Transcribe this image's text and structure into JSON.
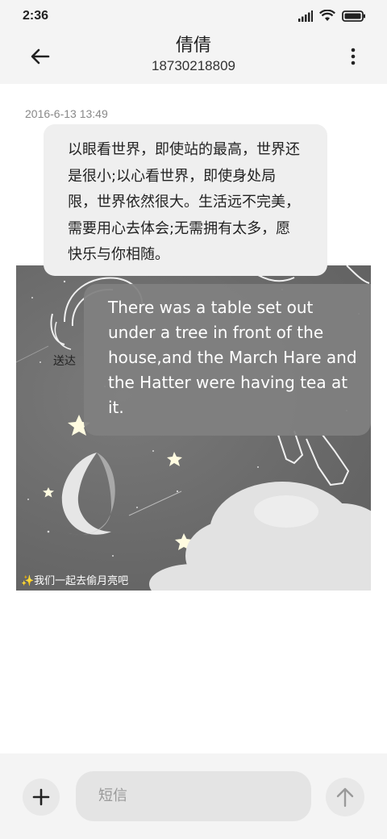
{
  "status_bar": {
    "time": "2:36",
    "icons": [
      "signal-icon",
      "wifi-icon",
      "battery-icon"
    ]
  },
  "header": {
    "contact_name": "倩倩",
    "contact_number": "18730218809",
    "back_icon": "back-arrow-icon",
    "more_icon": "more-vertical-icon"
  },
  "conversation": {
    "timestamp": "2016-6-13 13:49",
    "message_text": "以眼看世界，即使站的最高，世界还是很小;以心看世界，即使身处局限，世界依然很大。生活远不完美，需要用心去体会;无需拥有太多，愿快乐与你相随。",
    "status": "送达",
    "image_overlay_text": "There was a table set out under a tree in front of the house,and the March Hare and the Hatter were having tea at it.",
    "image_caption": "✨我们一起去偷月亮吧"
  },
  "composer": {
    "add_icon": "plus-icon",
    "placeholder": "短信",
    "send_icon": "send-arrow-icon"
  },
  "colors": {
    "background": "#ffffff",
    "header_background": "#f4f4f4",
    "bubble_background": "#efefef",
    "input_background": "#e4e4e4"
  }
}
